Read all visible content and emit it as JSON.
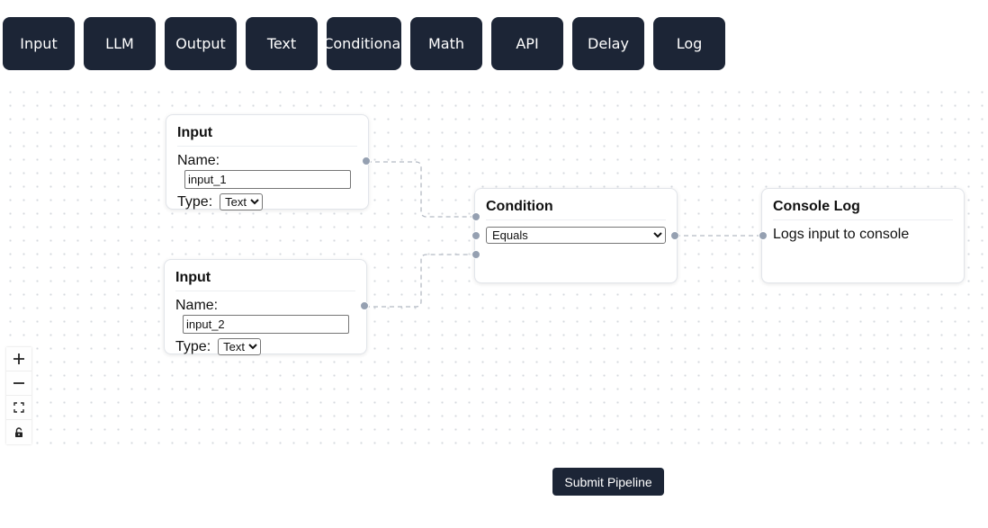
{
  "toolbar": {
    "buttons": [
      "Input",
      "LLM",
      "Output",
      "Text",
      "Conditional",
      "Math",
      "API",
      "Delay",
      "Log"
    ]
  },
  "nodes": {
    "input1": {
      "title": "Input",
      "name_label": "Name:",
      "name_value": "input_1",
      "type_label": "Type:",
      "type_value": "Text"
    },
    "input2": {
      "title": "Input",
      "name_label": "Name:",
      "name_value": "input_2",
      "type_label": "Type:",
      "type_value": "Text"
    },
    "condition": {
      "title": "Condition",
      "operator_value": "Equals"
    },
    "consolelog": {
      "title": "Console Log",
      "description": "Logs input to console"
    }
  },
  "controls": {
    "icons": [
      "plus-icon",
      "minus-icon",
      "fit-view-icon",
      "lock-icon"
    ]
  },
  "submit_label": "Submit Pipeline",
  "colors": {
    "button_bg": "#1c2536",
    "handle": "#95a0b1",
    "edge": "#b4bac4"
  }
}
